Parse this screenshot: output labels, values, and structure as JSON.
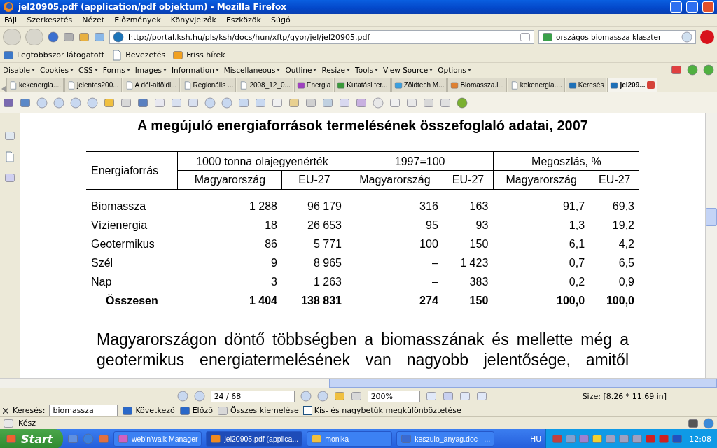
{
  "window": {
    "title": "jel20905.pdf (application/pdf objektum) - Mozilla Firefox"
  },
  "menu": [
    "Fájl",
    "Szerkesztés",
    "Nézet",
    "Előzmények",
    "Könyvjelzők",
    "Eszközök",
    "Súgó"
  ],
  "address": {
    "url": "http://portal.ksh.hu/pls/ksh/docs/hun/xftp/gyor/jel/jel20905.pdf"
  },
  "search": {
    "value": "országos biomassza klaszter"
  },
  "bookmarks": [
    "Legtöbbször látogatott",
    "Bevezetés",
    "Friss hírek"
  ],
  "dev_toolbar": [
    "Disable",
    "Cookies",
    "CSS",
    "Forms",
    "Images",
    "Information",
    "Miscellaneous",
    "Outline",
    "Resize",
    "Tools",
    "View Source",
    "Options"
  ],
  "tabs": [
    {
      "label": "kekenergia....",
      "selected": false
    },
    {
      "label": "jelentes200...",
      "selected": false
    },
    {
      "label": "A dél-alföldi...",
      "selected": false
    },
    {
      "label": "Regionális ...",
      "selected": false
    },
    {
      "label": "2008_12_0...",
      "selected": false
    },
    {
      "label": "Energia",
      "selected": false
    },
    {
      "label": "Kutatási ter...",
      "selected": false
    },
    {
      "label": "Zöldtech M...",
      "selected": false
    },
    {
      "label": "Biomassza.l...",
      "selected": false
    },
    {
      "label": "kekenergia....",
      "selected": false
    },
    {
      "label": "Keresés",
      "selected": false
    },
    {
      "label": "jel209...",
      "selected": true
    }
  ],
  "document": {
    "heading": "A megújuló energiaforrások termelésének összefoglaló adatai, 2007",
    "table": {
      "groups": [
        "1000 tonna olajegyenérték",
        "1997=100",
        "Megoszlás, %"
      ],
      "columns": [
        "Energiaforrás",
        "Magyarország",
        "EU-27",
        "Magyarország",
        "EU-27",
        "Magyarország",
        "EU-27"
      ],
      "rows": [
        {
          "kind": "data",
          "cells": [
            "Biomassza",
            "1 288",
            "96 179",
            "316",
            "163",
            "91,7",
            "69,3"
          ]
        },
        {
          "kind": "data",
          "cells": [
            "Vízienergia",
            "18",
            "26 653",
            "95",
            "93",
            "1,3",
            "19,2"
          ]
        },
        {
          "kind": "data",
          "cells": [
            "Geotermikus",
            "86",
            "5 771",
            "100",
            "150",
            "6,1",
            "4,2"
          ]
        },
        {
          "kind": "data",
          "cells": [
            "Szél",
            "9",
            "8 965",
            "–",
            "1 423",
            "0,7",
            "6,5"
          ]
        },
        {
          "kind": "data",
          "cells": [
            "Nap",
            "3",
            "1 263",
            "–",
            "383",
            "0,2",
            "0,9"
          ]
        },
        {
          "kind": "total",
          "cells": [
            "Összesen",
            "1 404",
            "138 831",
            "274",
            "150",
            "100,0",
            "100,0"
          ]
        }
      ]
    },
    "paragraph": "Magyarországon döntő többségben a biomasszának és mellette még a geotermikus energiatermelésének van nagyobb jelentősége, amitől"
  },
  "viewer_bar": {
    "page": "24 / 68",
    "zoom": "200%",
    "size": "Size: [8.26 * 11.69 in]"
  },
  "find_bar": {
    "label": "Keresés:",
    "value": "biomassza",
    "next": "Következő",
    "previous": "Előző",
    "highlight_all": "Összes kiemelése",
    "match_case": {
      "label": "Kis- és nagybetűk megkülönböztetése",
      "checked": false
    }
  },
  "status_bar": {
    "text": "Kész"
  },
  "taskbar": {
    "start": "Start",
    "tasks": [
      {
        "label": "web'n'walk Manager",
        "selected": false
      },
      {
        "label": "jel20905.pdf (applica...",
        "selected": true
      },
      {
        "label": "monika",
        "selected": false
      },
      {
        "label": "keszulo_anyag.doc - ...",
        "selected": false
      }
    ],
    "language": "HU",
    "clock": "12:08"
  }
}
